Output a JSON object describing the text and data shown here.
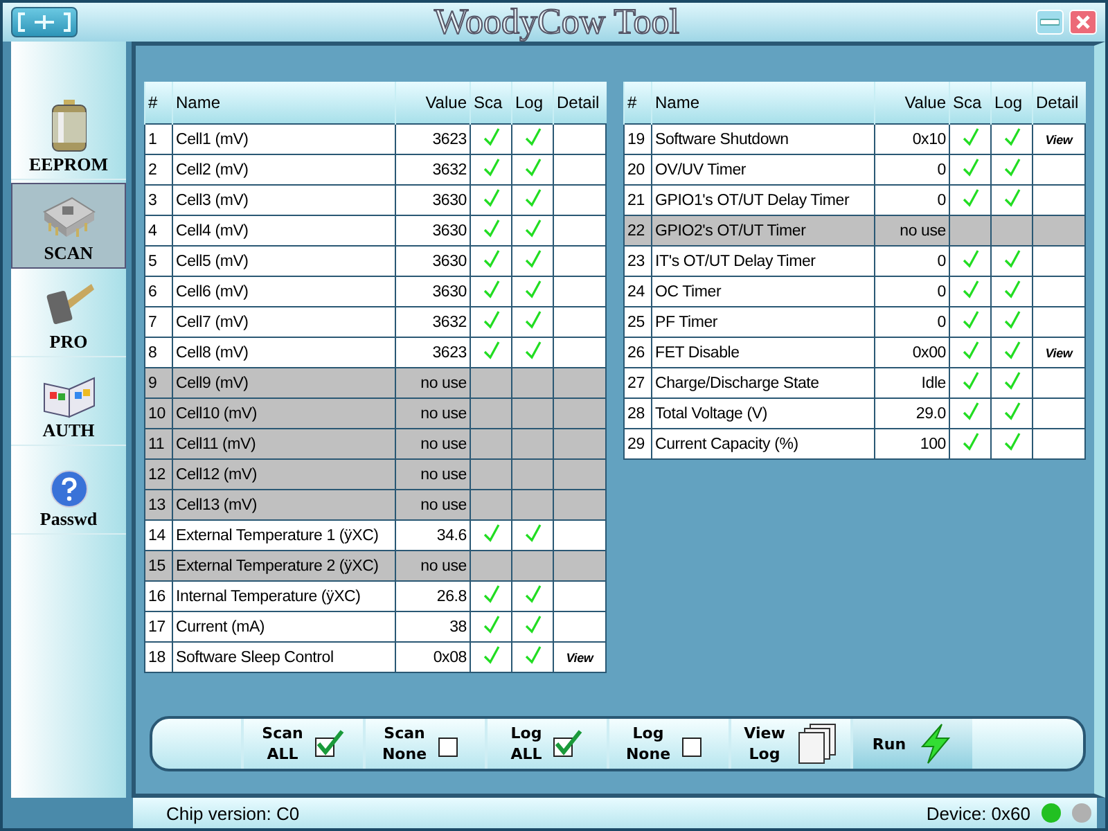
{
  "window": {
    "title": "WoodyCow Tool"
  },
  "sidebar": {
    "items": [
      {
        "label": "EEPROM",
        "selected": false
      },
      {
        "label": "SCAN",
        "selected": true
      },
      {
        "label": "PRO",
        "selected": false
      },
      {
        "label": "AUTH",
        "selected": false
      },
      {
        "label": "Passwd",
        "selected": false
      }
    ]
  },
  "tables": [
    {
      "columns": [
        "#",
        "Name",
        "Value",
        "Sca",
        "Log",
        "Detail"
      ],
      "rows": [
        {
          "no": "1",
          "name": "Cell1 (mV)",
          "value": "3623",
          "disabled": false,
          "scan": true,
          "log": true
        },
        {
          "no": "2",
          "name": "Cell2 (mV)",
          "value": "3632",
          "disabled": false,
          "scan": true,
          "log": true
        },
        {
          "no": "3",
          "name": "Cell3 (mV)",
          "value": "3630",
          "disabled": false,
          "scan": true,
          "log": true
        },
        {
          "no": "4",
          "name": "Cell4 (mV)",
          "value": "3630",
          "disabled": false,
          "scan": true,
          "log": true
        },
        {
          "no": "5",
          "name": "Cell5 (mV)",
          "value": "3630",
          "disabled": false,
          "scan": true,
          "log": true
        },
        {
          "no": "6",
          "name": "Cell6 (mV)",
          "value": "3630",
          "disabled": false,
          "scan": true,
          "log": true
        },
        {
          "no": "7",
          "name": "Cell7 (mV)",
          "value": "3632",
          "disabled": false,
          "scan": true,
          "log": true
        },
        {
          "no": "8",
          "name": "Cell8 (mV)",
          "value": "3623",
          "disabled": false,
          "scan": true,
          "log": true
        },
        {
          "no": "9",
          "name": "Cell9 (mV)",
          "value": "no use",
          "disabled": true,
          "scan": false,
          "log": false
        },
        {
          "no": "10",
          "name": "Cell10 (mV)",
          "value": "no use",
          "disabled": true,
          "scan": false,
          "log": false
        },
        {
          "no": "11",
          "name": "Cell11 (mV)",
          "value": "no use",
          "disabled": true,
          "scan": false,
          "log": false
        },
        {
          "no": "12",
          "name": "Cell12 (mV)",
          "value": "no use",
          "disabled": true,
          "scan": false,
          "log": false
        },
        {
          "no": "13",
          "name": "Cell13 (mV)",
          "value": "no use",
          "disabled": true,
          "scan": false,
          "log": false
        },
        {
          "no": "14",
          "name": "External Temperature 1 (ÿXC)",
          "value": "34.6",
          "disabled": false,
          "scan": true,
          "log": true
        },
        {
          "no": "15",
          "name": "External Temperature 2 (ÿXC)",
          "value": "no use",
          "disabled": true,
          "scan": false,
          "log": false
        },
        {
          "no": "16",
          "name": "Internal Temperature (ÿXC)",
          "value": "26.8",
          "disabled": false,
          "scan": true,
          "log": true
        },
        {
          "no": "17",
          "name": "Current (mA)",
          "value": "38",
          "disabled": false,
          "scan": true,
          "log": true
        },
        {
          "no": "18",
          "name": "Software Sleep Control",
          "value": "0x08",
          "disabled": false,
          "scan": true,
          "log": true,
          "detail": "View"
        }
      ]
    },
    {
      "columns": [
        "#",
        "Name",
        "Value",
        "Sca",
        "Log",
        "Detail"
      ],
      "rows": [
        {
          "no": "19",
          "name": "Software Shutdown",
          "value": "0x10",
          "disabled": false,
          "scan": true,
          "log": true,
          "detail": "View"
        },
        {
          "no": "20",
          "name": "OV/UV Timer",
          "value": "0",
          "disabled": false,
          "scan": true,
          "log": true
        },
        {
          "no": "21",
          "name": "GPIO1's OT/UT Delay Timer",
          "value": "0",
          "disabled": false,
          "scan": true,
          "log": true
        },
        {
          "no": "22",
          "name": "GPIO2's OT/UT Timer",
          "value": "no use",
          "disabled": true,
          "scan": false,
          "log": false
        },
        {
          "no": "23",
          "name": "IT's OT/UT Delay Timer",
          "value": "0",
          "disabled": false,
          "scan": true,
          "log": true
        },
        {
          "no": "24",
          "name": "OC Timer",
          "value": "0",
          "disabled": false,
          "scan": true,
          "log": true
        },
        {
          "no": "25",
          "name": "PF Timer",
          "value": "0",
          "disabled": false,
          "scan": true,
          "log": true
        },
        {
          "no": "26",
          "name": "FET Disable",
          "value": "0x00",
          "disabled": false,
          "scan": true,
          "log": true,
          "detail": "View"
        },
        {
          "no": "27",
          "name": "Charge/Discharge State",
          "value": "Idle",
          "disabled": false,
          "scan": true,
          "log": true
        },
        {
          "no": "28",
          "name": "Total Voltage (V)",
          "value": "29.0",
          "disabled": false,
          "scan": true,
          "log": true
        },
        {
          "no": "29",
          "name": "Current Capacity (%)",
          "value": "100",
          "disabled": false,
          "scan": true,
          "log": true
        }
      ]
    }
  ],
  "toolbar": [
    {
      "kind": "checkbox",
      "label": [
        "Scan",
        "ALL"
      ],
      "checked": true
    },
    {
      "kind": "checkbox",
      "label": [
        "Scan",
        "None"
      ],
      "checked": false
    },
    {
      "kind": "checkbox",
      "label": [
        "Log",
        "ALL"
      ],
      "checked": true
    },
    {
      "kind": "checkbox",
      "label": [
        "Log",
        "None"
      ],
      "checked": false
    },
    {
      "kind": "viewlog",
      "label": [
        "View",
        "Log"
      ]
    },
    {
      "kind": "run",
      "label": [
        "Run"
      ]
    }
  ],
  "status_bar": {
    "chip": "Chip version: C0",
    "device": "Device: 0x60",
    "lights": [
      {
        "color": "#22c022"
      },
      {
        "color": "#b0b0b0"
      }
    ]
  }
}
